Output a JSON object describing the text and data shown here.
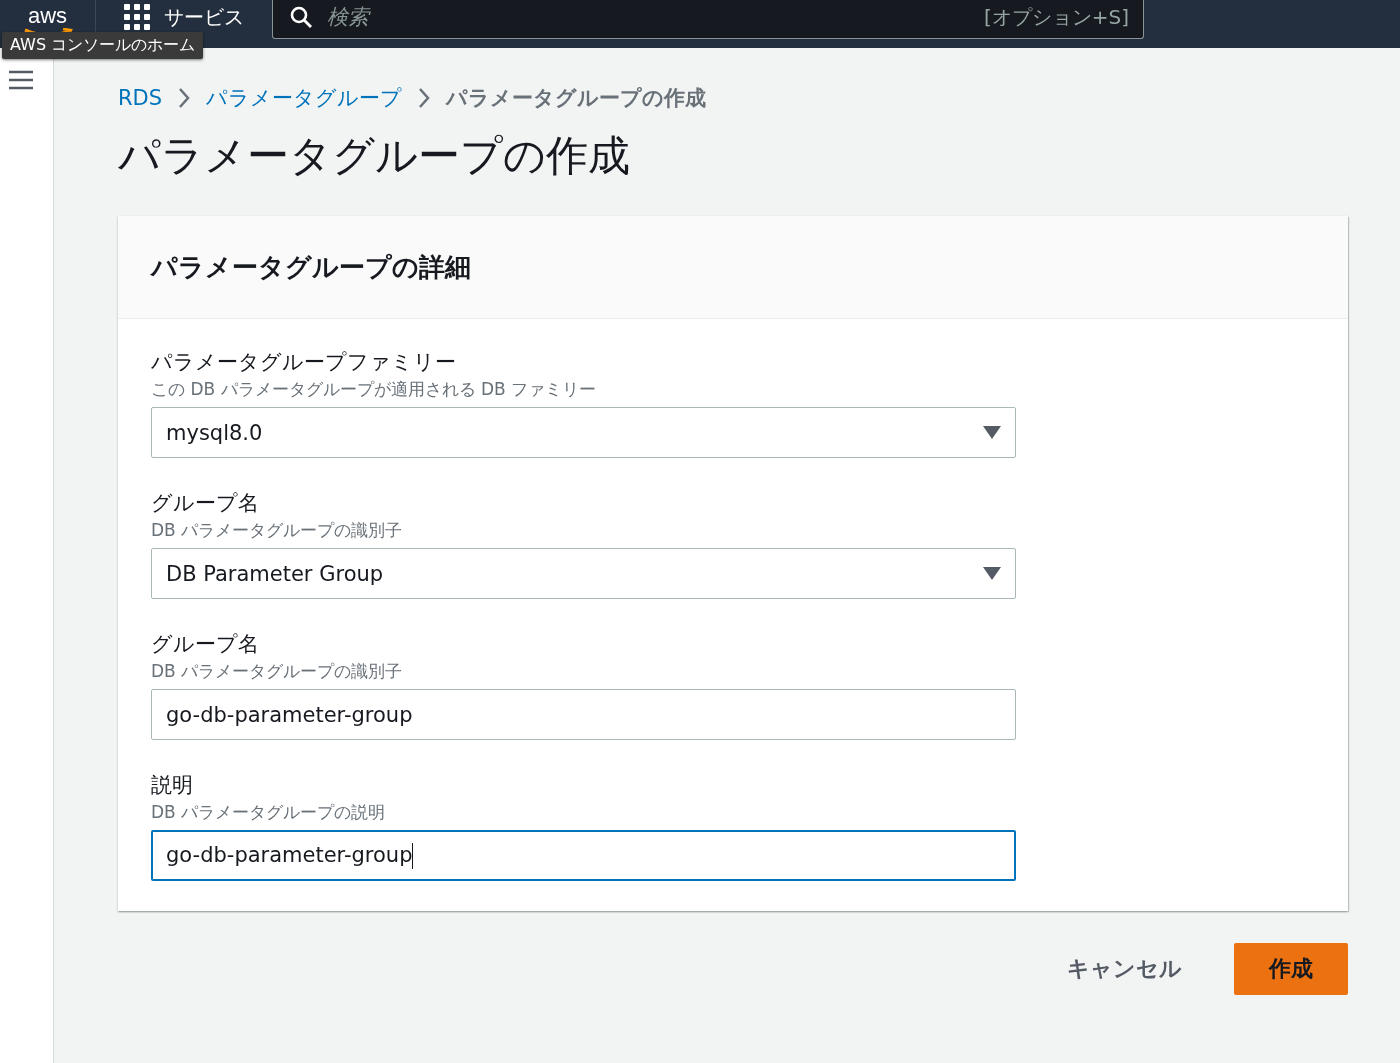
{
  "top_bar": {
    "logo": "aws",
    "services": "サービス",
    "search": {
      "placeholder": "検索",
      "shortcut": "[オプション+S]"
    },
    "tooltip": "AWS コンソールのホーム"
  },
  "breadcrumbs": [
    {
      "label": "RDS",
      "link": true
    },
    {
      "label": "パラメータグループ",
      "link": true
    },
    {
      "label": "パラメータグループの作成",
      "link": false
    }
  ],
  "page_title": "パラメータグループの作成",
  "panel": {
    "title": "パラメータグループの詳細",
    "fields": [
      {
        "label": "パラメータグループファミリー",
        "description": "この DB パラメータグループが適用される DB ファミリー",
        "kind": "select",
        "value": "mysql8.0",
        "focused": false
      },
      {
        "label": "グループ名",
        "description": "DB パラメータグループの識別子",
        "kind": "select",
        "value": "DB Parameter Group",
        "focused": false
      },
      {
        "label": "グループ名",
        "description": "DB パラメータグループの識別子",
        "kind": "input",
        "value": "go-db-parameter-group",
        "focused": false
      },
      {
        "label": "説明",
        "description": "DB パラメータグループの説明",
        "kind": "input",
        "value": "go-db-parameter-group",
        "focused": true
      }
    ]
  },
  "actions": {
    "cancel": "キャンセル",
    "submit": "作成"
  }
}
